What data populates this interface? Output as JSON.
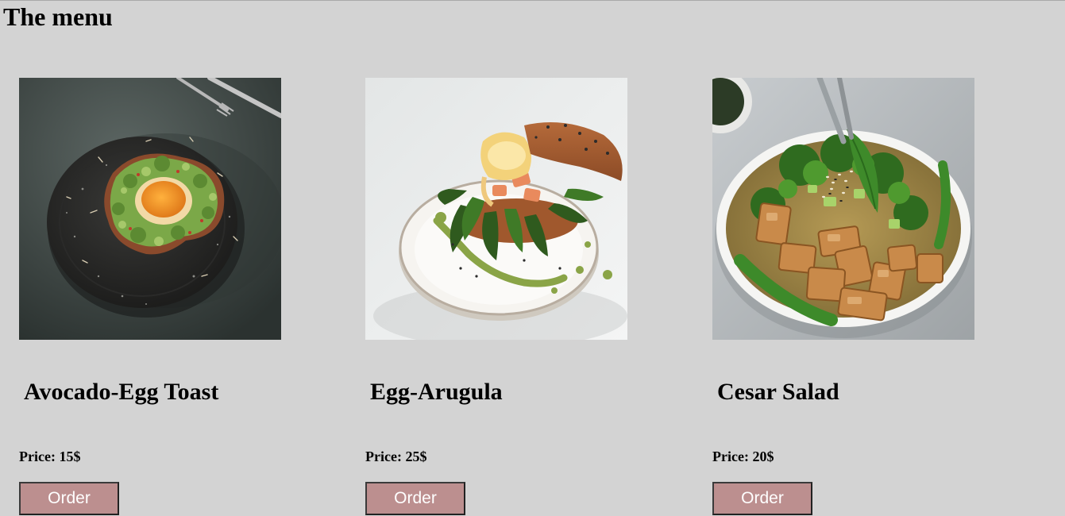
{
  "page": {
    "title": "The menu"
  },
  "menu": {
    "items": [
      {
        "name": "Avocado-Egg Toast",
        "price": "Price: 15$",
        "button": "Order",
        "photo": "avocado-egg-toast-photo"
      },
      {
        "name": "Egg-Arugula",
        "price": "Price: 25$",
        "button": "Order",
        "photo": "egg-arugula-photo"
      },
      {
        "name": "Cesar Salad",
        "price": "Price: 20$",
        "button": "Order",
        "photo": "cesar-salad-photo"
      }
    ]
  },
  "colors": {
    "background": "#d3d3d3",
    "button": "#bc8f8f",
    "button_text": "#ffffff"
  }
}
